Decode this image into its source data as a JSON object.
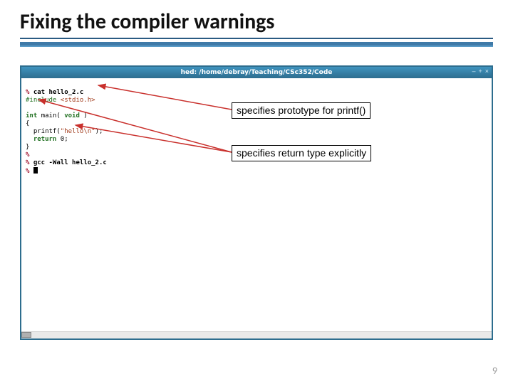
{
  "slide": {
    "title": "Fixing the compiler warnings",
    "page_number": "9"
  },
  "window": {
    "titlebar": "hed: /home/debray/Teaching/CSc352/Code",
    "controls": {
      "min": "–",
      "max": "+",
      "close": "×"
    }
  },
  "code": {
    "l1_prompt": "% ",
    "l1_cmd": "cat hello_2.c",
    "l2_hash": "#include ",
    "l2_hdr": "<stdio.h>",
    "l3": "",
    "l4_t": "int",
    "l4_m": " main( ",
    "l4_v": "void",
    "l4_e": " )",
    "l5": "{",
    "l6_a": "  printf(",
    "l6_s": "\"hello\\n\"",
    "l6_b": ");",
    "l7_a": "  ",
    "l7_r": "return",
    "l7_b": " 0;",
    "l8": "}",
    "l9": "%",
    "l10_prompt": "% ",
    "l10_cmd": "gcc -Wall hello_2.c",
    "l11": "% "
  },
  "annotations": {
    "printf": "specifies prototype for printf()",
    "rettype": "specifies return type explicitly"
  }
}
